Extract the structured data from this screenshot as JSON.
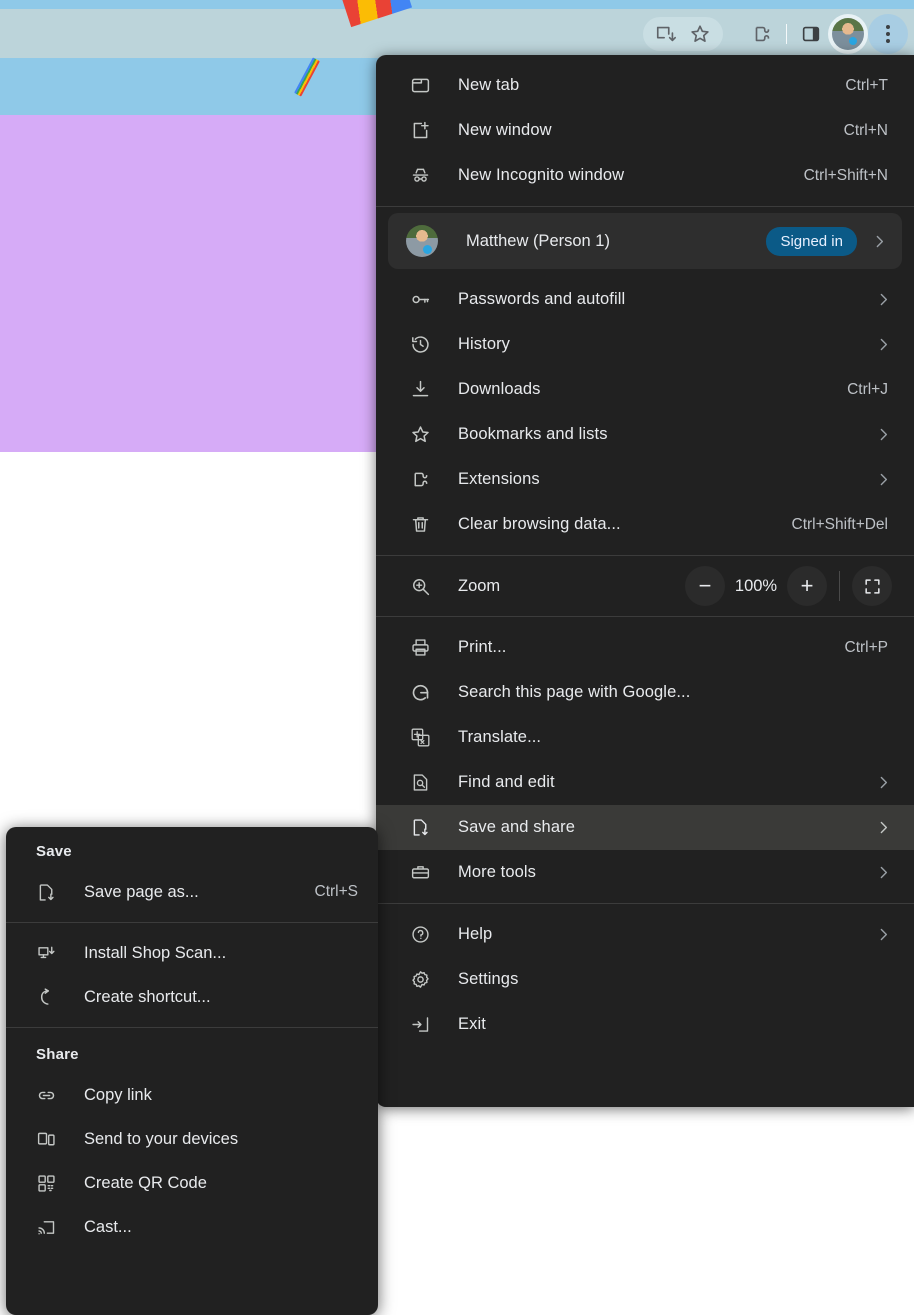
{
  "toolbar": {
    "items": [
      {
        "name": "install-app-icon",
        "label": "Install app"
      },
      {
        "name": "bookmark-star-icon",
        "label": "Bookmark this tab"
      },
      {
        "name": "extensions-icon",
        "label": "Extensions"
      },
      {
        "name": "side-panel-icon",
        "label": "Side panel"
      },
      {
        "name": "profile-avatar",
        "label": "Profile"
      },
      {
        "name": "three-dot-menu-icon",
        "label": "Customize and control Google Chrome"
      }
    ]
  },
  "menu": {
    "group_new": [
      {
        "icon": "new-tab-icon",
        "label": "New tab",
        "accel": "Ctrl+T",
        "chevron": false
      },
      {
        "icon": "new-window-icon",
        "label": "New window",
        "accel": "Ctrl+N",
        "chevron": false
      },
      {
        "icon": "incognito-icon",
        "label": "New Incognito window",
        "accel": "Ctrl+Shift+N",
        "chevron": false
      }
    ],
    "profile": {
      "name": "Matthew (Person 1)",
      "badge": "Signed in"
    },
    "group_browse": [
      {
        "icon": "key-icon",
        "label": "Passwords and autofill",
        "accel": "",
        "chevron": true
      },
      {
        "icon": "history-icon",
        "label": "History",
        "accel": "",
        "chevron": true
      },
      {
        "icon": "download-icon",
        "label": "Downloads",
        "accel": "Ctrl+J",
        "chevron": false
      },
      {
        "icon": "star-icon",
        "label": "Bookmarks and lists",
        "accel": "",
        "chevron": true
      },
      {
        "icon": "puzzle-icon",
        "label": "Extensions",
        "accel": "",
        "chevron": true
      },
      {
        "icon": "trash-icon",
        "label": "Clear browsing data...",
        "accel": "Ctrl+Shift+Del",
        "chevron": false
      }
    ],
    "zoom": {
      "icon": "zoom-magnifier-icon",
      "label": "Zoom",
      "value": "100%",
      "minus_label": "−",
      "plus_label": "+",
      "fullscreen_icon": "fullscreen-icon"
    },
    "group_page": [
      {
        "icon": "printer-icon",
        "label": "Print...",
        "accel": "Ctrl+P",
        "chevron": false,
        "highlighted": false
      },
      {
        "icon": "google-g-icon",
        "label": "Search this page with Google...",
        "accel": "",
        "chevron": false,
        "highlighted": false
      },
      {
        "icon": "translate-icon",
        "label": "Translate...",
        "accel": "",
        "chevron": false,
        "highlighted": false
      },
      {
        "icon": "find-edit-icon",
        "label": "Find and edit",
        "accel": "",
        "chevron": true,
        "highlighted": false
      },
      {
        "icon": "save-share-icon",
        "label": "Save and share",
        "accel": "",
        "chevron": true,
        "highlighted": true
      },
      {
        "icon": "toolbox-icon",
        "label": "More tools",
        "accel": "",
        "chevron": true,
        "highlighted": false
      }
    ],
    "group_app": [
      {
        "icon": "help-icon",
        "label": "Help",
        "accel": "",
        "chevron": true
      },
      {
        "icon": "settings-icon",
        "label": "Settings",
        "accel": "",
        "chevron": false
      },
      {
        "icon": "exit-icon",
        "label": "Exit",
        "accel": "",
        "chevron": false
      }
    ]
  },
  "submenu": {
    "save_header": "Save",
    "save_items": [
      {
        "icon": "save-page-icon",
        "label": "Save page as...",
        "accel": "Ctrl+S"
      }
    ],
    "install_items": [
      {
        "icon": "install-monitor-icon",
        "label": "Install Shop Scan...",
        "accel": ""
      },
      {
        "icon": "create-shortcut-icon",
        "label": "Create shortcut...",
        "accel": ""
      }
    ],
    "share_header": "Share",
    "share_items": [
      {
        "icon": "link-icon",
        "label": "Copy link",
        "accel": ""
      },
      {
        "icon": "devices-icon",
        "label": "Send to your devices",
        "accel": ""
      },
      {
        "icon": "qr-code-icon",
        "label": "Create QR Code",
        "accel": ""
      },
      {
        "icon": "cast-icon",
        "label": "Cast...",
        "accel": ""
      }
    ]
  },
  "colors": {
    "menu_bg": "#212121",
    "menu_highlight": "#3a3a38",
    "badge_blue": "#0b5a87",
    "text": "#e8eaed",
    "accel_text": "#bdc1c6",
    "page_purple": "#d6abf7",
    "page_sky": "#8fc9e8",
    "toolbar_band": "#bcd4da"
  }
}
